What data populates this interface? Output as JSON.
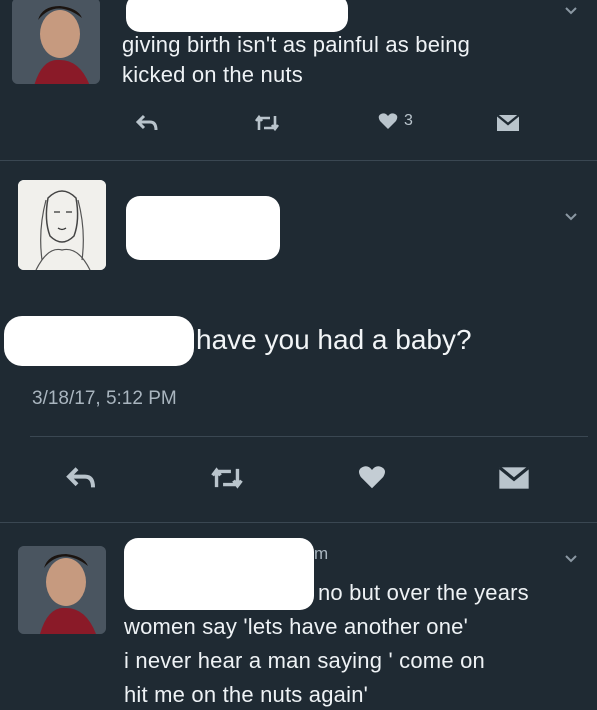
{
  "tweet1": {
    "text_line1": "giving birth isn't as painful as being",
    "text_line2": "kicked on the nuts",
    "like_count": "3"
  },
  "tweet2": {
    "text": "have you had a baby?",
    "timestamp": "3/18/17, 5:12 PM"
  },
  "tweet3": {
    "handle_fragment": "m",
    "text_line1": "no but over the years",
    "text_line2": "women say 'lets have another one'",
    "text_line3": "i never hear a man saying ' come on",
    "text_line4": "hit me on the nuts again'"
  },
  "icons": {
    "reply": "reply-icon",
    "retweet": "retweet-icon",
    "like": "heart-icon",
    "dm": "message-icon",
    "chevron": "chevron-down-icon"
  },
  "colors": {
    "background": "#1f2a33",
    "text": "#eef2f5",
    "muted": "#a9b5bf"
  }
}
